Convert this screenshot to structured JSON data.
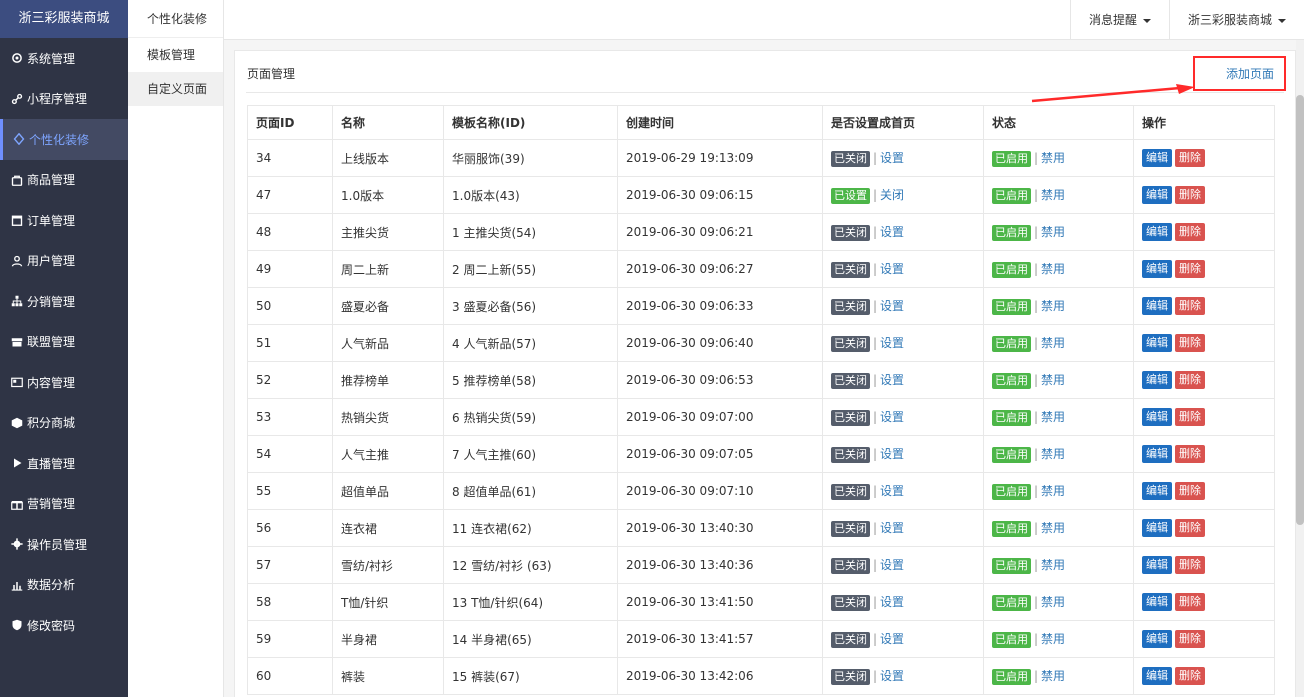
{
  "brand": "浙三彩服装商城",
  "sidebar": {
    "items": [
      {
        "label": "系统管理",
        "icon": "gear-icon"
      },
      {
        "label": "小程序管理",
        "icon": "link-icon"
      },
      {
        "label": "个性化装修",
        "icon": "diamond-icon",
        "active": true
      },
      {
        "label": "商品管理",
        "icon": "bag-icon"
      },
      {
        "label": "订单管理",
        "icon": "calendar-icon"
      },
      {
        "label": "用户管理",
        "icon": "user-icon"
      },
      {
        "label": "分销管理",
        "icon": "sitemap-icon"
      },
      {
        "label": "联盟管理",
        "icon": "store-icon"
      },
      {
        "label": "内容管理",
        "icon": "newspaper-icon"
      },
      {
        "label": "积分商城",
        "icon": "cube-icon"
      },
      {
        "label": "直播管理",
        "icon": "play-icon"
      },
      {
        "label": "营销管理",
        "icon": "gift-icon"
      },
      {
        "label": "操作员管理",
        "icon": "cog-icon"
      },
      {
        "label": "数据分析",
        "icon": "bar-chart-icon"
      },
      {
        "label": "修改密码",
        "icon": "shield-icon"
      }
    ]
  },
  "subnav": {
    "title": "个性化装修",
    "items": [
      {
        "label": "模板管理"
      },
      {
        "label": "自定义页面",
        "active": true
      }
    ]
  },
  "topbar": {
    "notifications": "消息提醒",
    "store": "浙三彩服装商城"
  },
  "panel": {
    "title": "页面管理",
    "add_page": "添加页面"
  },
  "table": {
    "headers": [
      "页面ID",
      "名称",
      "模板名称(ID)",
      "创建时间",
      "是否设置成首页",
      "状态",
      "操作"
    ],
    "rows": [
      {
        "id": "34",
        "name": "上线版本",
        "template": "华丽服饰(39)",
        "created": "2019-06-29 19:13:09",
        "home_label": "已关闭",
        "home_action": "设置",
        "status_label": "已启用",
        "status_action": "禁用"
      },
      {
        "id": "47",
        "name": "1.0版本",
        "template": "1.0版本(43)",
        "created": "2019-06-30 09:06:15",
        "home_label": "已设置",
        "home_action": "关闭",
        "status_label": "已启用",
        "status_action": "禁用",
        "home_on": true
      },
      {
        "id": "48",
        "name": "主推尖货",
        "template": "1 主推尖货(54)",
        "created": "2019-06-30 09:06:21",
        "home_label": "已关闭",
        "home_action": "设置",
        "status_label": "已启用",
        "status_action": "禁用"
      },
      {
        "id": "49",
        "name": "周二上新",
        "template": "2 周二上新(55)",
        "created": "2019-06-30 09:06:27",
        "home_label": "已关闭",
        "home_action": "设置",
        "status_label": "已启用",
        "status_action": "禁用"
      },
      {
        "id": "50",
        "name": "盛夏必备",
        "template": "3 盛夏必备(56)",
        "created": "2019-06-30 09:06:33",
        "home_label": "已关闭",
        "home_action": "设置",
        "status_label": "已启用",
        "status_action": "禁用"
      },
      {
        "id": "51",
        "name": "人气新品",
        "template": "4 人气新品(57)",
        "created": "2019-06-30 09:06:40",
        "home_label": "已关闭",
        "home_action": "设置",
        "status_label": "已启用",
        "status_action": "禁用"
      },
      {
        "id": "52",
        "name": "推荐榜单",
        "template": "5 推荐榜单(58)",
        "created": "2019-06-30 09:06:53",
        "home_label": "已关闭",
        "home_action": "设置",
        "status_label": "已启用",
        "status_action": "禁用"
      },
      {
        "id": "53",
        "name": "热销尖货",
        "template": "6 热销尖货(59)",
        "created": "2019-06-30 09:07:00",
        "home_label": "已关闭",
        "home_action": "设置",
        "status_label": "已启用",
        "status_action": "禁用"
      },
      {
        "id": "54",
        "name": "人气主推",
        "template": "7 人气主推(60)",
        "created": "2019-06-30 09:07:05",
        "home_label": "已关闭",
        "home_action": "设置",
        "status_label": "已启用",
        "status_action": "禁用"
      },
      {
        "id": "55",
        "name": "超值单品",
        "template": "8 超值单品(61)",
        "created": "2019-06-30 09:07:10",
        "home_label": "已关闭",
        "home_action": "设置",
        "status_label": "已启用",
        "status_action": "禁用"
      },
      {
        "id": "56",
        "name": "连衣裙",
        "template": "11 连衣裙(62)",
        "created": "2019-06-30 13:40:30",
        "home_label": "已关闭",
        "home_action": "设置",
        "status_label": "已启用",
        "status_action": "禁用"
      },
      {
        "id": "57",
        "name": "雪纺/衬衫",
        "template": "12 雪纺/衬衫 (63)",
        "created": "2019-06-30 13:40:36",
        "home_label": "已关闭",
        "home_action": "设置",
        "status_label": "已启用",
        "status_action": "禁用"
      },
      {
        "id": "58",
        "name": "T恤/针织",
        "template": "13 T恤/针织(64)",
        "created": "2019-06-30 13:41:50",
        "home_label": "已关闭",
        "home_action": "设置",
        "status_label": "已启用",
        "status_action": "禁用"
      },
      {
        "id": "59",
        "name": "半身裙",
        "template": "14 半身裙(65)",
        "created": "2019-06-30 13:41:57",
        "home_label": "已关闭",
        "home_action": "设置",
        "status_label": "已启用",
        "status_action": "禁用"
      },
      {
        "id": "60",
        "name": "裤装",
        "template": "15 裤装(67)",
        "created": "2019-06-30 13:42:06",
        "home_label": "已关闭",
        "home_action": "设置",
        "status_label": "已启用",
        "status_action": "禁用"
      }
    ],
    "edit_label": "编辑",
    "delete_label": "删除"
  },
  "colors": {
    "sidebar_bg": "#2f3445",
    "brand_bg": "#3c4d80",
    "active_text": "#7ea5ff",
    "link": "#337ab7",
    "label_off": "#555d6b",
    "label_on": "#4cb648",
    "btn_edit": "#1e6ec0",
    "btn_delete": "#d9534f",
    "annotation": "#ff2a2a"
  }
}
